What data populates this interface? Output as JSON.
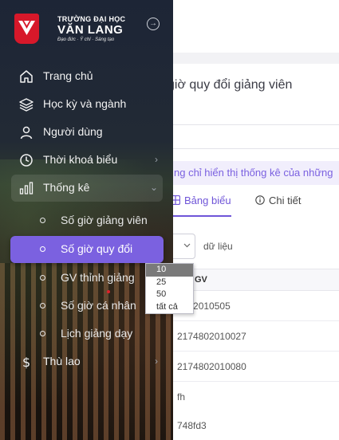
{
  "brand": {
    "top": "TRƯỜNG ĐẠI HỌC",
    "name": "VĂN LANG",
    "tagline": "Đạo đức · Ý chí · Sáng tạo",
    "color": "#d7182a"
  },
  "sidebar": {
    "collapse_icon": "arrow-circle-right-icon",
    "items": [
      {
        "label": "Trang chủ",
        "icon": "home-icon"
      },
      {
        "label": "Học kỳ và ngành",
        "icon": "layers-icon"
      },
      {
        "label": "Người dùng",
        "icon": "user-icon"
      },
      {
        "label": "Thời khoá biểu",
        "icon": "clock-icon",
        "has_chevron": true,
        "chevron": "›"
      },
      {
        "label": "Thống kê",
        "icon": "bar-chart-icon",
        "has_chevron": true,
        "chevron": "⌄"
      },
      {
        "label": "Thù lao",
        "icon": "dollar-icon",
        "has_chevron": true,
        "chevron": "›"
      }
    ],
    "sub_items": [
      {
        "label": "Số giờ giảng viên"
      },
      {
        "label": "Số giờ quy đổi",
        "active": true
      },
      {
        "label": "GV thỉnh giảng"
      },
      {
        "label": "Số giờ cá nhân"
      },
      {
        "label": "Lịch giảng dạy"
      }
    ],
    "active_color": "#7b61e0"
  },
  "main": {
    "title": "giờ quy đổi giảng viên",
    "info": "ng chỉ hiển thị thống kê của những",
    "tabs": [
      {
        "label": "Bảng biểu",
        "icon": "grid-icon",
        "active": true
      },
      {
        "label": "Chi tiết",
        "icon": "info-icon"
      }
    ],
    "length_label": "dữ liệu",
    "column_header": "GV",
    "rows": [
      "4802010505",
      "2174802010027",
      "2174802010080",
      "fh",
      "748fd3"
    ]
  },
  "dropdown": {
    "options": [
      "10",
      "25",
      "50",
      "tất cả"
    ],
    "selected": "10"
  }
}
